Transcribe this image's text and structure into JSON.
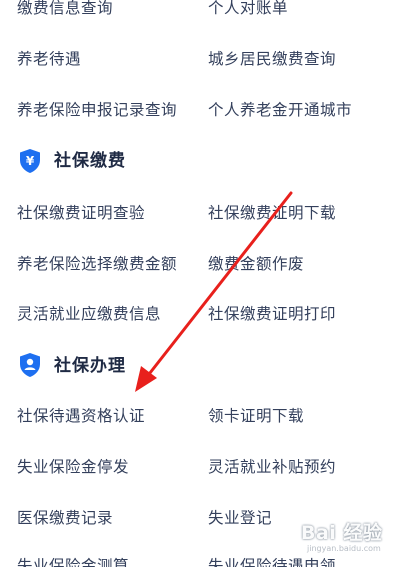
{
  "top_rows": [
    {
      "left": "缴费信息查询",
      "right": "个人对账单"
    },
    {
      "left": "养老待遇",
      "right": "城乡居民缴费查询"
    },
    {
      "left": "养老保险申报记录查询",
      "right": "个人养老金开通城市"
    }
  ],
  "section_payment": {
    "title": "社保缴费",
    "icon": "yuan-shield-icon",
    "rows": [
      {
        "left": "社保缴费证明查验",
        "right": "社保缴费证明下载"
      },
      {
        "left": "养老保险选择缴费金额",
        "right": "缴费金额作废"
      },
      {
        "left": "灵活就业应缴费信息",
        "right": "社保缴费证明打印"
      }
    ]
  },
  "section_handling": {
    "title": "社保办理",
    "icon": "person-shield-icon",
    "rows": [
      {
        "left": "社保待遇资格认证",
        "right": "领卡证明下载"
      },
      {
        "left": "失业保险金停发",
        "right": "灵活就业补贴预约"
      },
      {
        "left": "医保缴费记录",
        "right": "失业登记"
      },
      {
        "left": "失业保险金测算",
        "right": "失业保险待遇申领"
      }
    ]
  },
  "watermark": {
    "main": "Bai 经验",
    "url": "jingyan.baidu.com"
  },
  "colors": {
    "accent_blue": "#1e6ff0",
    "arrow_red": "#e8201c",
    "text": "#34405c"
  }
}
